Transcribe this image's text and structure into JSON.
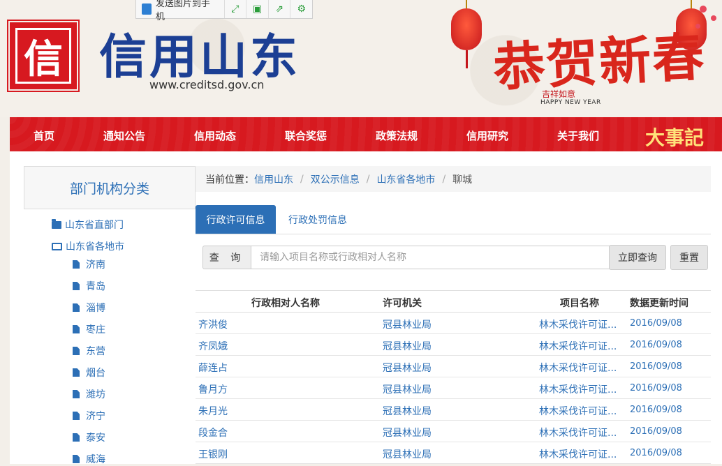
{
  "toolbar": {
    "send_label": "发送图片到手机"
  },
  "header": {
    "logo_char": "信",
    "site_title": "信用山东",
    "site_url": "www.creditsd.gov.cn",
    "banner_title": "恭贺新春",
    "banner_sub": "吉祥如意",
    "banner_en": "HAPPY NEW YEAR"
  },
  "nav": {
    "items": [
      "首页",
      "通知公告",
      "信用动态",
      "联合奖惩",
      "政策法规",
      "信用研究",
      "关于我们"
    ],
    "special": "大事記"
  },
  "sidebar": {
    "title": "部门机构分类",
    "groups": [
      {
        "label": "山东省直部门"
      },
      {
        "label": "山东省各地市"
      }
    ],
    "cities": [
      "济南",
      "青岛",
      "淄博",
      "枣庄",
      "东营",
      "烟台",
      "潍坊",
      "济宁",
      "泰安",
      "威海"
    ]
  },
  "breadcrumb": {
    "prefix": "当前位置：",
    "links": [
      "信用山东",
      "双公示信息",
      "山东省各地市"
    ],
    "current": "聊城"
  },
  "tabs": [
    "行政许可信息",
    "行政处罚信息"
  ],
  "search": {
    "label": "查 询",
    "placeholder": "请输入项目名称或行政相对人名称",
    "query_label": "立即查询",
    "reset_label": "重置"
  },
  "table": {
    "headers": [
      "行政相对人名称",
      "许可机关",
      "项目名称",
      "数据更新时间"
    ],
    "rows": [
      [
        "齐洪俊",
        "冠县林业局",
        "林木采伐许可证...",
        "2016/09/08"
      ],
      [
        "齐凤娥",
        "冠县林业局",
        "林木采伐许可证...",
        "2016/09/08"
      ],
      [
        "薛连占",
        "冠县林业局",
        "林木采伐许可证...",
        "2016/09/08"
      ],
      [
        "鲁月方",
        "冠县林业局",
        "林木采伐许可证...",
        "2016/09/08"
      ],
      [
        "朱月光",
        "冠县林业局",
        "林木采伐许可证...",
        "2016/09/08"
      ],
      [
        "段金合",
        "冠县林业局",
        "林木采伐许可证...",
        "2016/09/08"
      ],
      [
        "王银刚",
        "冠县林业局",
        "林木采伐许可证...",
        "2016/09/08"
      ]
    ]
  }
}
